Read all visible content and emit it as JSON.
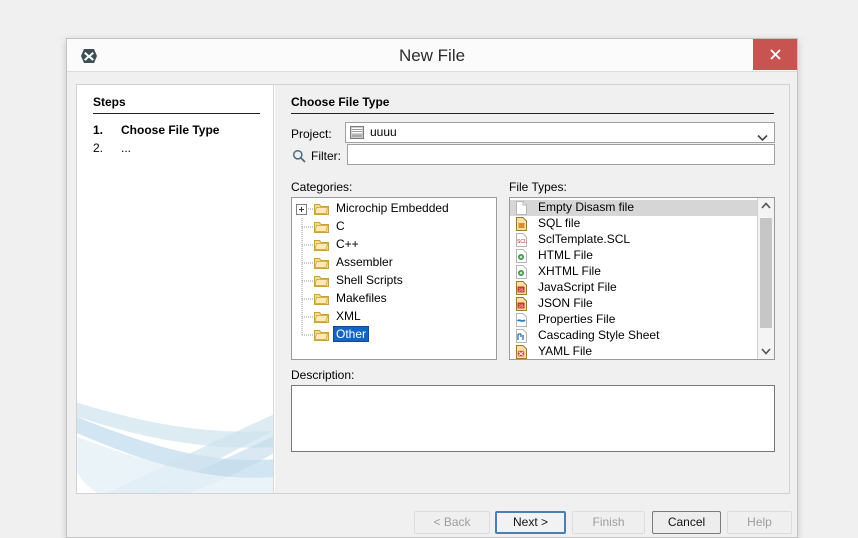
{
  "window": {
    "title": "New File",
    "app_icon": "mplab-x-icon",
    "close_label": "×"
  },
  "steps": {
    "heading": "Steps",
    "items": [
      {
        "num": "1.",
        "label": "Choose File Type",
        "current": true
      },
      {
        "num": "2.",
        "label": "...",
        "current": false
      }
    ]
  },
  "main": {
    "section_title": "Choose File Type",
    "project": {
      "label": "Project:",
      "value": "uuuu",
      "icon": "project-icon",
      "arrow_icon": "chevron-down-icon"
    },
    "filter": {
      "label": "Filter:",
      "value": "",
      "placeholder": "",
      "icon": "search-icon"
    },
    "categories": {
      "label": "Categories:",
      "items": [
        {
          "label": "Microchip Embedded",
          "expandable": true,
          "selected": false
        },
        {
          "label": "C",
          "expandable": false,
          "selected": false
        },
        {
          "label": "C++",
          "expandable": false,
          "selected": false
        },
        {
          "label": "Assembler",
          "expandable": false,
          "selected": false
        },
        {
          "label": "Shell Scripts",
          "expandable": false,
          "selected": false
        },
        {
          "label": "Makefiles",
          "expandable": false,
          "selected": false
        },
        {
          "label": "XML",
          "expandable": false,
          "selected": false
        },
        {
          "label": "Other",
          "expandable": false,
          "selected": true
        }
      ]
    },
    "file_types": {
      "label": "File Types:",
      "items": [
        {
          "label": "Empty Disasm file",
          "icon": "blank-file-icon",
          "selected": true
        },
        {
          "label": "SQL file",
          "icon": "sql-file-icon",
          "selected": false
        },
        {
          "label": "SclTemplate.SCL",
          "icon": "scl-file-icon",
          "selected": false
        },
        {
          "label": "HTML File",
          "icon": "html-file-icon",
          "selected": false
        },
        {
          "label": "XHTML File",
          "icon": "xhtml-file-icon",
          "selected": false
        },
        {
          "label": "JavaScript File",
          "icon": "javascript-file-icon",
          "selected": false
        },
        {
          "label": "JSON File",
          "icon": "json-file-icon",
          "selected": false
        },
        {
          "label": "Properties File",
          "icon": "properties-file-icon",
          "selected": false
        },
        {
          "label": "Cascading Style Sheet",
          "icon": "css-file-icon",
          "selected": false
        },
        {
          "label": "YAML File",
          "icon": "yaml-file-icon",
          "selected": false
        }
      ],
      "scrollbar": {
        "up_icon": "chevron-up-icon",
        "down_icon": "chevron-down-icon"
      }
    },
    "description": {
      "label": "Description:",
      "value": ""
    }
  },
  "buttons": {
    "back": {
      "label": "< Back",
      "state": "disabled"
    },
    "next": {
      "label": "Next >",
      "state": "default-focused"
    },
    "finish": {
      "label": "Finish",
      "state": "disabled"
    },
    "cancel": {
      "label": "Cancel",
      "state": "enabled"
    },
    "help": {
      "label": "Help",
      "state": "disabled"
    }
  },
  "colors": {
    "close_button": "#c75450",
    "selection_blue": "#1564c0",
    "selection_gray": "#d6d6d6",
    "focus_border": "#4a7fb5",
    "dialog_bg": "#f0f0f0",
    "swoosh": "#cfe3ee"
  }
}
